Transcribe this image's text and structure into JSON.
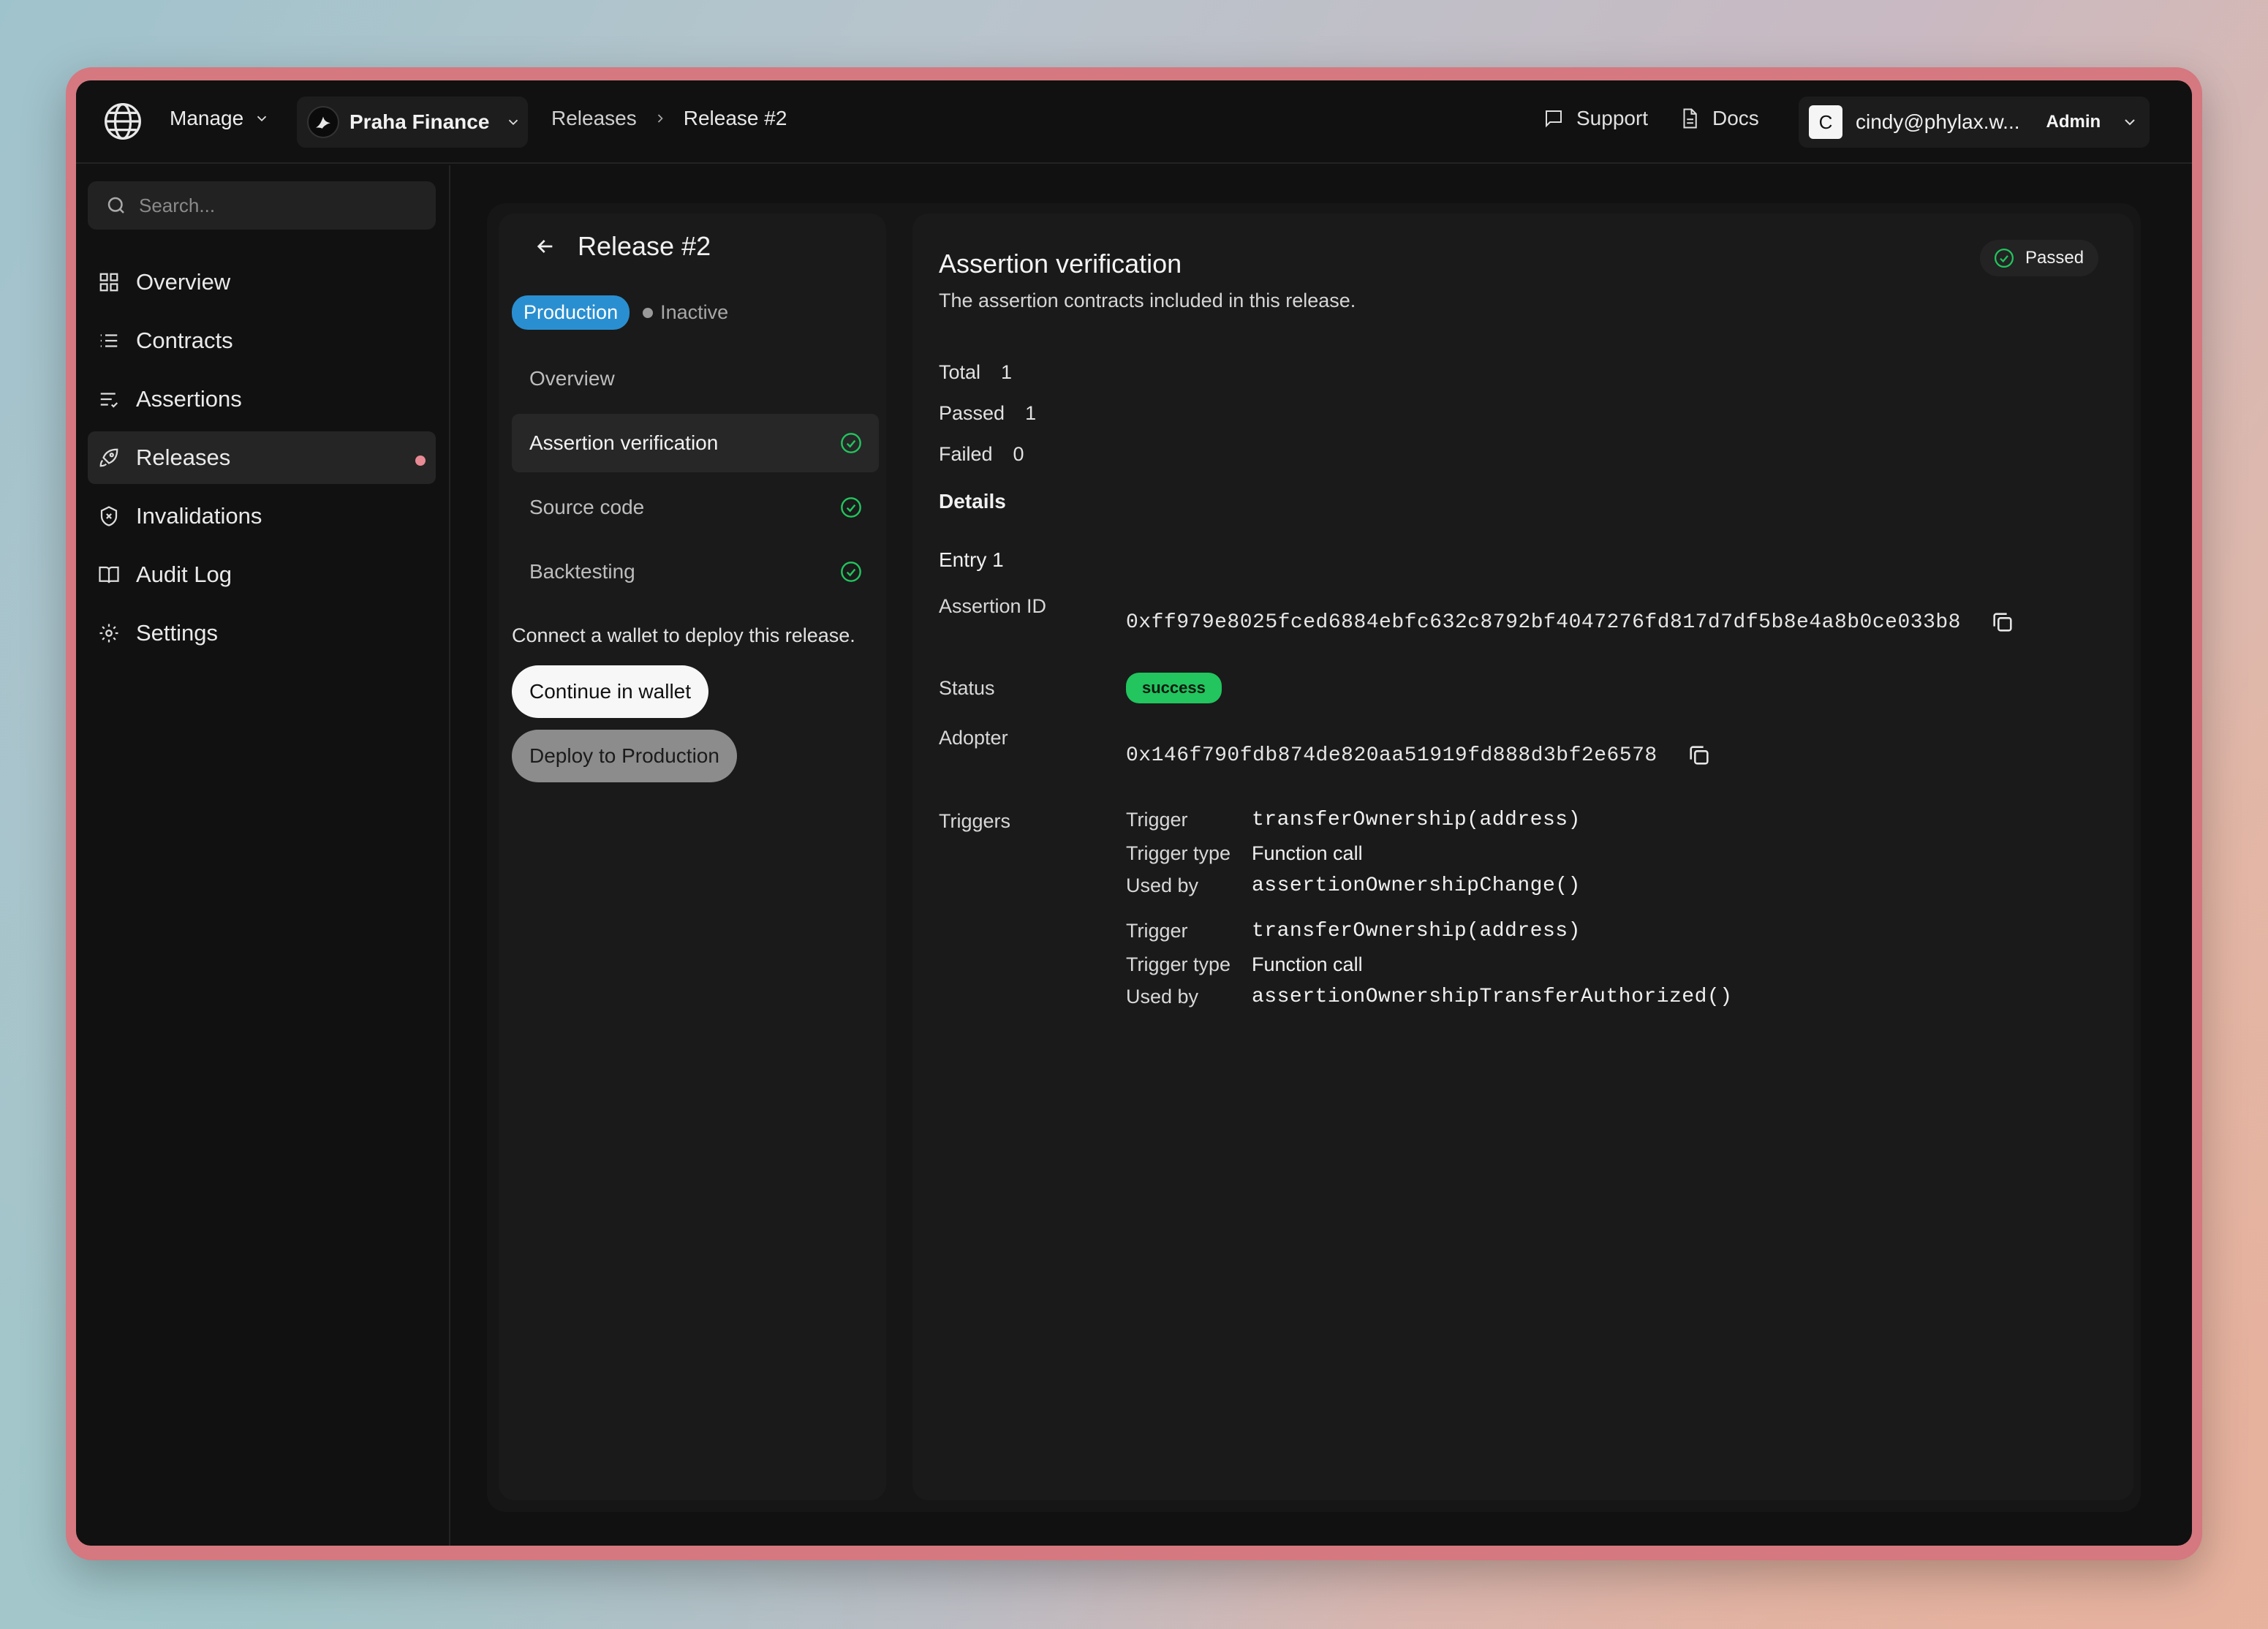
{
  "topbar": {
    "manage_label": "Manage",
    "org_name": "Praha Finance",
    "breadcrumb": [
      "Releases",
      "Release #2"
    ],
    "support_label": "Support",
    "docs_label": "Docs",
    "user_initial": "C",
    "user_email": "cindy@phylax.w...",
    "user_role": "Admin"
  },
  "sidebar": {
    "search_placeholder": "Search...",
    "items": [
      {
        "label": "Overview",
        "icon": "grid-icon"
      },
      {
        "label": "Contracts",
        "icon": "list-icon"
      },
      {
        "label": "Assertions",
        "icon": "list-check-icon"
      },
      {
        "label": "Releases",
        "icon": "rocket-icon",
        "active": true,
        "notification": true
      },
      {
        "label": "Invalidations",
        "icon": "shield-alert-icon"
      },
      {
        "label": "Audit Log",
        "icon": "book-icon"
      },
      {
        "label": "Settings",
        "icon": "gear-icon"
      }
    ]
  },
  "release": {
    "title": "Release #2",
    "environment": "Production",
    "state": "Inactive",
    "steps": [
      {
        "label": "Overview",
        "checked": false
      },
      {
        "label": "Assertion verification",
        "checked": true,
        "active": true
      },
      {
        "label": "Source code",
        "checked": true
      },
      {
        "label": "Backtesting",
        "checked": true
      }
    ],
    "connect_text": "Connect a wallet to deploy this release.",
    "continue_button": "Continue in wallet",
    "deploy_button": "Deploy to Production"
  },
  "verification": {
    "title": "Assertion verification",
    "subtitle": "The assertion contracts included in this release.",
    "status_pill": "Passed",
    "stats": [
      {
        "label": "Total",
        "value": "1"
      },
      {
        "label": "Passed",
        "value": "1"
      },
      {
        "label": "Failed",
        "value": "0"
      }
    ],
    "details_heading": "Details",
    "entry_heading": "Entry 1",
    "assertion_id_label": "Assertion ID",
    "assertion_id": "0xff979e8025fced6884ebfc632c8792bf4047276fd817d7df5b8e4a8b0ce033b8",
    "status_label": "Status",
    "status_value": "success",
    "adopter_label": "Adopter",
    "adopter": "0x146f790fdb874de820aa51919fd888d3bf2e6578",
    "triggers_label": "Triggers",
    "trigger_key": "Trigger",
    "trigger_type_key": "Trigger type",
    "used_by_key": "Used by",
    "triggers": [
      {
        "trigger": "transferOwnership(address)",
        "type": "Function call",
        "used_by": "assertionOwnershipChange()"
      },
      {
        "trigger": "transferOwnership(address)",
        "type": "Function call",
        "used_by": "assertionOwnershipTransferAuthorized()"
      }
    ]
  },
  "colors": {
    "accent_blue": "#2a8fd0",
    "success_green": "#22c55e",
    "notification_pink": "#e88a94",
    "frame_pink": "#d57880"
  }
}
